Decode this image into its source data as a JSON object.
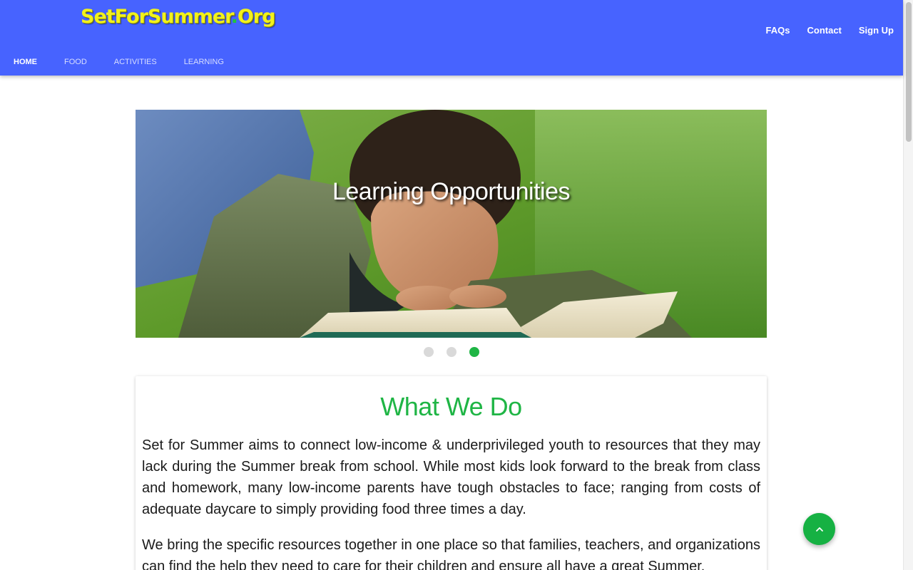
{
  "header": {
    "logo_main": "SetForSummer",
    "logo_dot": ".",
    "logo_tld": "Org",
    "right_nav": [
      "FAQs",
      "Contact",
      "Sign Up"
    ],
    "main_nav": [
      "HOME",
      "FOOD",
      "ACTIVITIES",
      "LEARNING"
    ],
    "active_main_nav": "HOME",
    "brand_color": "#4763ff",
    "logo_color": "#f2f21a"
  },
  "carousel": {
    "caption": "Learning Opportunities",
    "slide_count": 3,
    "active_index": 2,
    "image_subject": "boy-reading-book-on-grass"
  },
  "about": {
    "title": "What We Do",
    "paragraphs": [
      "Set for Summer aims to connect low-income & underprivileged youth to resources that they may lack during the Summer break from school. While most kids look forward to the break from class and homework, many low-income parents have tough obstacles to face; ranging from costs of adequate daycare to simply providing food three times a day.",
      "We bring the specific resources together in one place so that families, teachers, and organizations can find the help they need to care for their children and ensure all have a great Summer."
    ],
    "accent_color": "#1fb545"
  },
  "fab": {
    "icon": "chevron-up-icon"
  }
}
